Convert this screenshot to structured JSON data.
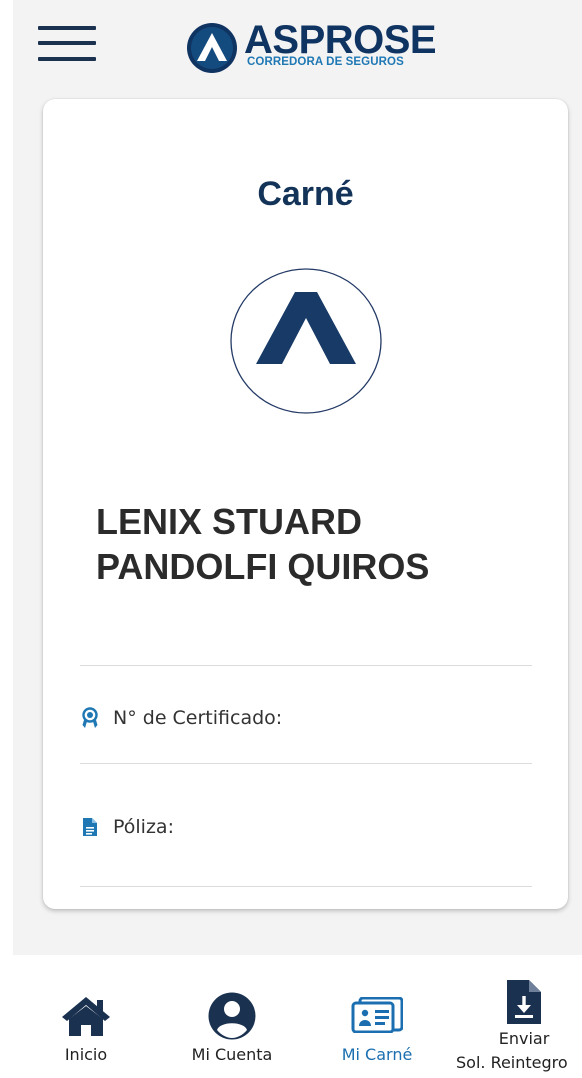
{
  "header": {
    "brand_name": "ASPROSE",
    "brand_tagline": "CORREDORA DE SEGUROS"
  },
  "card": {
    "title": "Carné",
    "holder_name": "LENIX STUARD PANDOLFI QUIROS",
    "fields": [
      {
        "label": "N° de Certificado:",
        "value": "",
        "icon": "certificate-ribbon-icon"
      },
      {
        "label": "Póliza:",
        "value": "",
        "icon": "document-icon"
      }
    ]
  },
  "bottom_nav": {
    "items": [
      {
        "label": "Inicio",
        "icon": "home-icon",
        "active": false
      },
      {
        "label": "Mi Cuenta",
        "icon": "user-circle-icon",
        "active": false
      },
      {
        "label": "Mi Carné",
        "icon": "id-card-icon",
        "active": true
      },
      {
        "label_line1": "Enviar",
        "label_line2": "Sol. Reintegro",
        "icon": "document-download-icon",
        "active": false
      }
    ]
  },
  "colors": {
    "brand_navy": "#0f3462",
    "brand_blue": "#1f78b4",
    "active_nav": "#1b6fb0",
    "icon_dark": "#1b3150",
    "field_icon": "#1f78b4"
  }
}
